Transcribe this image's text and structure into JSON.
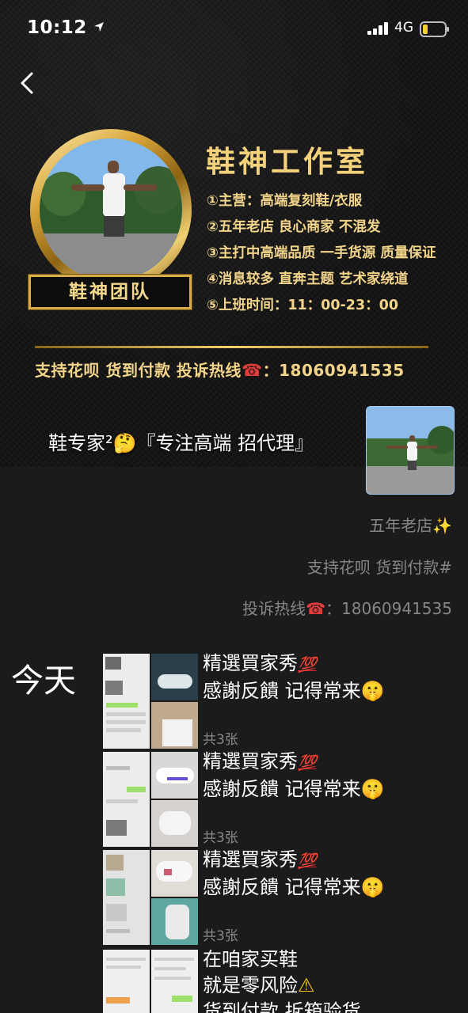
{
  "status_bar": {
    "time": "10:12",
    "network": "4G"
  },
  "cover": {
    "studio_title": "鞋神工作室",
    "avatar_label": "鞋神团队",
    "features": [
      "①主营：高端复刻鞋/衣服",
      "②五年老店 良心商家 不混发",
      "③主打中高端品质 一手货源 质量保证",
      "④消息较多 直奔主题 艺术家绕道",
      "⑤上班时间：11：00-23：00"
    ],
    "hotline_banner": {
      "before": "支持花呗 货到付款 投诉热线",
      "icon": "☎",
      "after": "：18060941535"
    }
  },
  "profile": {
    "name": "鞋专家²🤔『专注高端 招代理』"
  },
  "bio": {
    "line1": {
      "text": "五年老店",
      "emoji": "✨"
    },
    "line2": "支持花呗 货到付款#",
    "line3": {
      "before": "投诉热线",
      "icon": "☎",
      "after": "：18060941535"
    }
  },
  "feed": {
    "date_label": "今天",
    "posts": [
      {
        "line1": "精選買家秀",
        "badge": "💯",
        "line2": "感謝反饋 记得常来",
        "line2_emoji": "🤫",
        "count": "共3张"
      },
      {
        "line1": "精選買家秀",
        "badge": "💯",
        "line2": "感謝反饋 记得常来",
        "line2_emoji": "🤫",
        "count": "共3张"
      },
      {
        "line1": "精選買家秀",
        "badge": "💯",
        "line2": "感謝反饋 记得常来",
        "line2_emoji": "🤫",
        "count": "共3张"
      },
      {
        "line1": "在咱家买鞋",
        "line2": "就是零风险",
        "line2_emoji": "⚠",
        "line3": "货到付款 拆箱验货"
      }
    ]
  },
  "colors": {
    "gold": "#f2d48a",
    "background": "#1b1b1b",
    "muted_text": "#868686"
  }
}
